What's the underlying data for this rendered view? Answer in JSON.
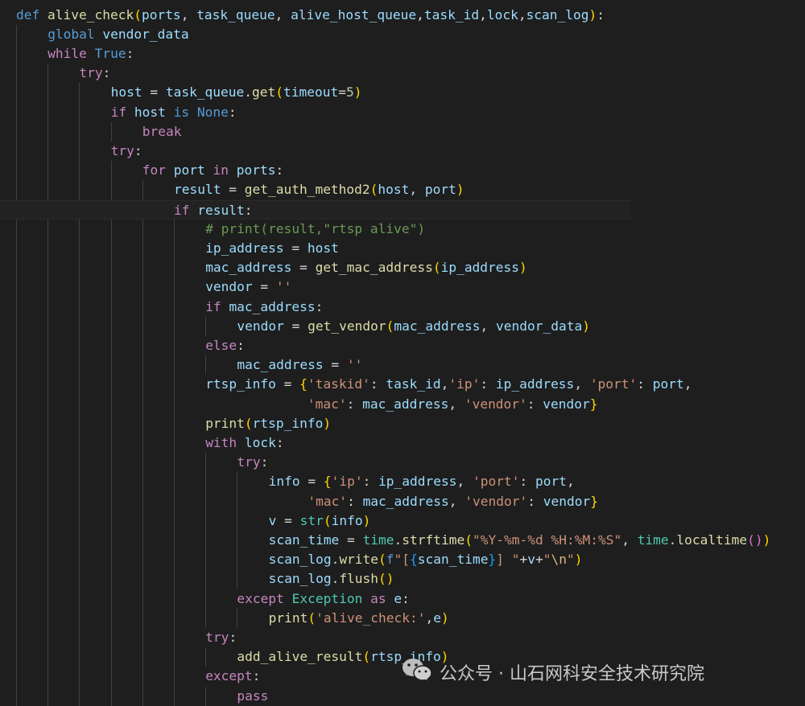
{
  "code_lines": [
    {
      "indent": 0,
      "tokens": [
        [
          "def",
          "kw"
        ],
        [
          " ",
          "op"
        ],
        [
          "alive_check",
          "fn"
        ],
        [
          "(",
          "p1"
        ],
        [
          "ports",
          "var"
        ],
        [
          ", ",
          "op"
        ],
        [
          "task_queue",
          "var"
        ],
        [
          ", ",
          "op"
        ],
        [
          "alive_host_queue",
          "var"
        ],
        [
          ",",
          "op"
        ],
        [
          "task_id",
          "var"
        ],
        [
          ",",
          "op"
        ],
        [
          "lock",
          "var"
        ],
        [
          ",",
          "op"
        ],
        [
          "scan_log",
          "var"
        ],
        [
          ")",
          "p1"
        ],
        [
          ":",
          "op"
        ]
      ]
    },
    {
      "indent": 1,
      "tokens": [
        [
          "global",
          "kw"
        ],
        [
          " ",
          "op"
        ],
        [
          "vendor_data",
          "var"
        ]
      ]
    },
    {
      "indent": 1,
      "tokens": [
        [
          "while",
          "ctl"
        ],
        [
          " ",
          "op"
        ],
        [
          "True",
          "kw"
        ],
        [
          ":",
          "op"
        ]
      ]
    },
    {
      "indent": 2,
      "tokens": [
        [
          "try",
          "ctl"
        ],
        [
          ":",
          "op"
        ]
      ]
    },
    {
      "indent": 3,
      "tokens": [
        [
          "host",
          "var"
        ],
        [
          " = ",
          "op"
        ],
        [
          "task_queue",
          "var"
        ],
        [
          ".",
          "op"
        ],
        [
          "get",
          "fn"
        ],
        [
          "(",
          "p1"
        ],
        [
          "timeout",
          "var"
        ],
        [
          "=",
          "op"
        ],
        [
          "5",
          "num"
        ],
        [
          ")",
          "p1"
        ]
      ]
    },
    {
      "indent": 3,
      "tokens": [
        [
          "if",
          "ctl"
        ],
        [
          " ",
          "op"
        ],
        [
          "host",
          "var"
        ],
        [
          " ",
          "op"
        ],
        [
          "is",
          "kw"
        ],
        [
          " ",
          "op"
        ],
        [
          "None",
          "kw"
        ],
        [
          ":",
          "op"
        ]
      ]
    },
    {
      "indent": 4,
      "tokens": [
        [
          "break",
          "ctl"
        ]
      ]
    },
    {
      "indent": 3,
      "tokens": [
        [
          "try",
          "ctl"
        ],
        [
          ":",
          "op"
        ]
      ]
    },
    {
      "indent": 4,
      "tokens": [
        [
          "for",
          "ctl"
        ],
        [
          " ",
          "op"
        ],
        [
          "port",
          "var"
        ],
        [
          " ",
          "op"
        ],
        [
          "in",
          "ctl"
        ],
        [
          " ",
          "op"
        ],
        [
          "ports",
          "var"
        ],
        [
          ":",
          "op"
        ]
      ]
    },
    {
      "indent": 5,
      "tokens": [
        [
          "result",
          "var"
        ],
        [
          " = ",
          "op"
        ],
        [
          "get_auth_method2",
          "fn"
        ],
        [
          "(",
          "p1"
        ],
        [
          "host",
          "var"
        ],
        [
          ", ",
          "op"
        ],
        [
          "port",
          "var"
        ],
        [
          ")",
          "p1"
        ]
      ]
    },
    {
      "indent": 5,
      "tokens": [
        [
          "if",
          "ctl"
        ],
        [
          " ",
          "op"
        ],
        [
          "result",
          "var"
        ],
        [
          ":",
          "op"
        ]
      ]
    },
    {
      "indent": 6,
      "tokens": [
        [
          "# print(result,\"rtsp alive\")",
          "com"
        ]
      ]
    },
    {
      "indent": 6,
      "tokens": [
        [
          "ip_address",
          "var"
        ],
        [
          " = ",
          "op"
        ],
        [
          "host",
          "var"
        ]
      ]
    },
    {
      "indent": 6,
      "tokens": [
        [
          "mac_address",
          "var"
        ],
        [
          " = ",
          "op"
        ],
        [
          "get_mac_address",
          "fn"
        ],
        [
          "(",
          "p1"
        ],
        [
          "ip_address",
          "var"
        ],
        [
          ")",
          "p1"
        ]
      ]
    },
    {
      "indent": 6,
      "tokens": [
        [
          "vendor",
          "var"
        ],
        [
          " = ",
          "op"
        ],
        [
          "''",
          "str"
        ]
      ]
    },
    {
      "indent": 6,
      "tokens": [
        [
          "if",
          "ctl"
        ],
        [
          " ",
          "op"
        ],
        [
          "mac_address",
          "var"
        ],
        [
          ":",
          "op"
        ]
      ]
    },
    {
      "indent": 7,
      "tokens": [
        [
          "vendor",
          "var"
        ],
        [
          " = ",
          "op"
        ],
        [
          "get_vendor",
          "fn"
        ],
        [
          "(",
          "p1"
        ],
        [
          "mac_address",
          "var"
        ],
        [
          ", ",
          "op"
        ],
        [
          "vendor_data",
          "var"
        ],
        [
          ")",
          "p1"
        ]
      ]
    },
    {
      "indent": 6,
      "tokens": [
        [
          "else",
          "ctl"
        ],
        [
          ":",
          "op"
        ]
      ]
    },
    {
      "indent": 7,
      "tokens": [
        [
          "mac_address",
          "var"
        ],
        [
          " = ",
          "op"
        ],
        [
          "''",
          "str"
        ]
      ]
    },
    {
      "indent": 6,
      "tokens": [
        [
          "rtsp_info",
          "var"
        ],
        [
          " = ",
          "op"
        ],
        [
          "{",
          "p1"
        ],
        [
          "'taskid'",
          "str"
        ],
        [
          ": ",
          "op"
        ],
        [
          "task_id",
          "var"
        ],
        [
          ",",
          "op"
        ],
        [
          "'ip'",
          "str"
        ],
        [
          ": ",
          "op"
        ],
        [
          "ip_address",
          "var"
        ],
        [
          ", ",
          "op"
        ],
        [
          "'port'",
          "str"
        ],
        [
          ": ",
          "op"
        ],
        [
          "port",
          "var"
        ],
        [
          ",",
          "op"
        ]
      ]
    },
    {
      "indent": 6,
      "tokens": [
        [
          "             ",
          "op"
        ],
        [
          "'mac'",
          "str"
        ],
        [
          ": ",
          "op"
        ],
        [
          "mac_address",
          "var"
        ],
        [
          ", ",
          "op"
        ],
        [
          "'vendor'",
          "str"
        ],
        [
          ": ",
          "op"
        ],
        [
          "vendor",
          "var"
        ],
        [
          "}",
          "p1"
        ]
      ]
    },
    {
      "indent": 6,
      "tokens": [
        [
          "print",
          "fn"
        ],
        [
          "(",
          "p1"
        ],
        [
          "rtsp_info",
          "var"
        ],
        [
          ")",
          "p1"
        ]
      ]
    },
    {
      "indent": 6,
      "tokens": [
        [
          "with",
          "ctl"
        ],
        [
          " ",
          "op"
        ],
        [
          "lock",
          "var"
        ],
        [
          ":",
          "op"
        ]
      ]
    },
    {
      "indent": 7,
      "tokens": [
        [
          "try",
          "ctl"
        ],
        [
          ":",
          "op"
        ]
      ]
    },
    {
      "indent": 8,
      "tokens": [
        [
          "info",
          "var"
        ],
        [
          " = ",
          "op"
        ],
        [
          "{",
          "p1"
        ],
        [
          "'ip'",
          "str"
        ],
        [
          ": ",
          "op"
        ],
        [
          "ip_address",
          "var"
        ],
        [
          ", ",
          "op"
        ],
        [
          "'port'",
          "str"
        ],
        [
          ": ",
          "op"
        ],
        [
          "port",
          "var"
        ],
        [
          ",",
          "op"
        ]
      ]
    },
    {
      "indent": 8,
      "tokens": [
        [
          "     ",
          "op"
        ],
        [
          "'mac'",
          "str"
        ],
        [
          ": ",
          "op"
        ],
        [
          "mac_address",
          "var"
        ],
        [
          ", ",
          "op"
        ],
        [
          "'vendor'",
          "str"
        ],
        [
          ": ",
          "op"
        ],
        [
          "vendor",
          "var"
        ],
        [
          "}",
          "p1"
        ]
      ]
    },
    {
      "indent": 8,
      "tokens": [
        [
          "v",
          "var"
        ],
        [
          " = ",
          "op"
        ],
        [
          "str",
          "cls"
        ],
        [
          "(",
          "p1"
        ],
        [
          "info",
          "var"
        ],
        [
          ")",
          "p1"
        ]
      ]
    },
    {
      "indent": 8,
      "tokens": [
        [
          "scan_time",
          "var"
        ],
        [
          " = ",
          "op"
        ],
        [
          "time",
          "cls"
        ],
        [
          ".",
          "op"
        ],
        [
          "strftime",
          "fn"
        ],
        [
          "(",
          "p1"
        ],
        [
          "\"%Y-%m-%d %H:%M:%S\"",
          "str"
        ],
        [
          ", ",
          "op"
        ],
        [
          "time",
          "cls"
        ],
        [
          ".",
          "op"
        ],
        [
          "localtime",
          "fn"
        ],
        [
          "(",
          "p2"
        ],
        [
          ")",
          "p2"
        ],
        [
          ")",
          "p1"
        ]
      ]
    },
    {
      "indent": 8,
      "tokens": [
        [
          "scan_log",
          "var"
        ],
        [
          ".",
          "op"
        ],
        [
          "write",
          "fn"
        ],
        [
          "(",
          "p1"
        ],
        [
          "f",
          "kw"
        ],
        [
          "\"[",
          "str"
        ],
        [
          "{",
          "p3"
        ],
        [
          "scan_time",
          "var"
        ],
        [
          "}",
          "p3"
        ],
        [
          "] \"",
          "str"
        ],
        [
          "+",
          "op"
        ],
        [
          "v",
          "var"
        ],
        [
          "+",
          "op"
        ],
        [
          "\"",
          "str"
        ],
        [
          "\\n",
          "esc"
        ],
        [
          "\"",
          "str"
        ],
        [
          ")",
          "p1"
        ]
      ]
    },
    {
      "indent": 8,
      "tokens": [
        [
          "scan_log",
          "var"
        ],
        [
          ".",
          "op"
        ],
        [
          "flush",
          "fn"
        ],
        [
          "(",
          "p1"
        ],
        [
          ")",
          "p1"
        ]
      ]
    },
    {
      "indent": 7,
      "tokens": [
        [
          "except",
          "ctl"
        ],
        [
          " ",
          "op"
        ],
        [
          "Exception",
          "cls"
        ],
        [
          " ",
          "op"
        ],
        [
          "as",
          "ctl"
        ],
        [
          " ",
          "op"
        ],
        [
          "e",
          "var"
        ],
        [
          ":",
          "op"
        ]
      ]
    },
    {
      "indent": 8,
      "tokens": [
        [
          "print",
          "fn"
        ],
        [
          "(",
          "p1"
        ],
        [
          "'alive_check:'",
          "str"
        ],
        [
          ",",
          "op"
        ],
        [
          "e",
          "var"
        ],
        [
          ")",
          "p1"
        ]
      ]
    },
    {
      "indent": 6,
      "tokens": [
        [
          "try",
          "ctl"
        ],
        [
          ":",
          "op"
        ]
      ]
    },
    {
      "indent": 7,
      "tokens": [
        [
          "add_alive_result",
          "fn"
        ],
        [
          "(",
          "p1"
        ],
        [
          "rtsp_info",
          "var"
        ],
        [
          ")",
          "p1"
        ]
      ]
    },
    {
      "indent": 6,
      "tokens": [
        [
          "except",
          "ctl"
        ],
        [
          ":",
          "op"
        ]
      ]
    },
    {
      "indent": 7,
      "tokens": [
        [
          "pass",
          "ctl"
        ]
      ]
    }
  ],
  "current_line_index": 10,
  "watermark": {
    "icon": "wechat-icon",
    "text": "公众号 · 山石网科安全技术研究院"
  },
  "colors": {
    "background": "#1e1e1e",
    "keyword": "#569cd6",
    "control": "#c586c0",
    "function": "#dcdcaa",
    "variable": "#9cdcfe",
    "class": "#4ec9b0",
    "string": "#ce9178",
    "number": "#b5cea8",
    "comment": "#6a9955"
  }
}
